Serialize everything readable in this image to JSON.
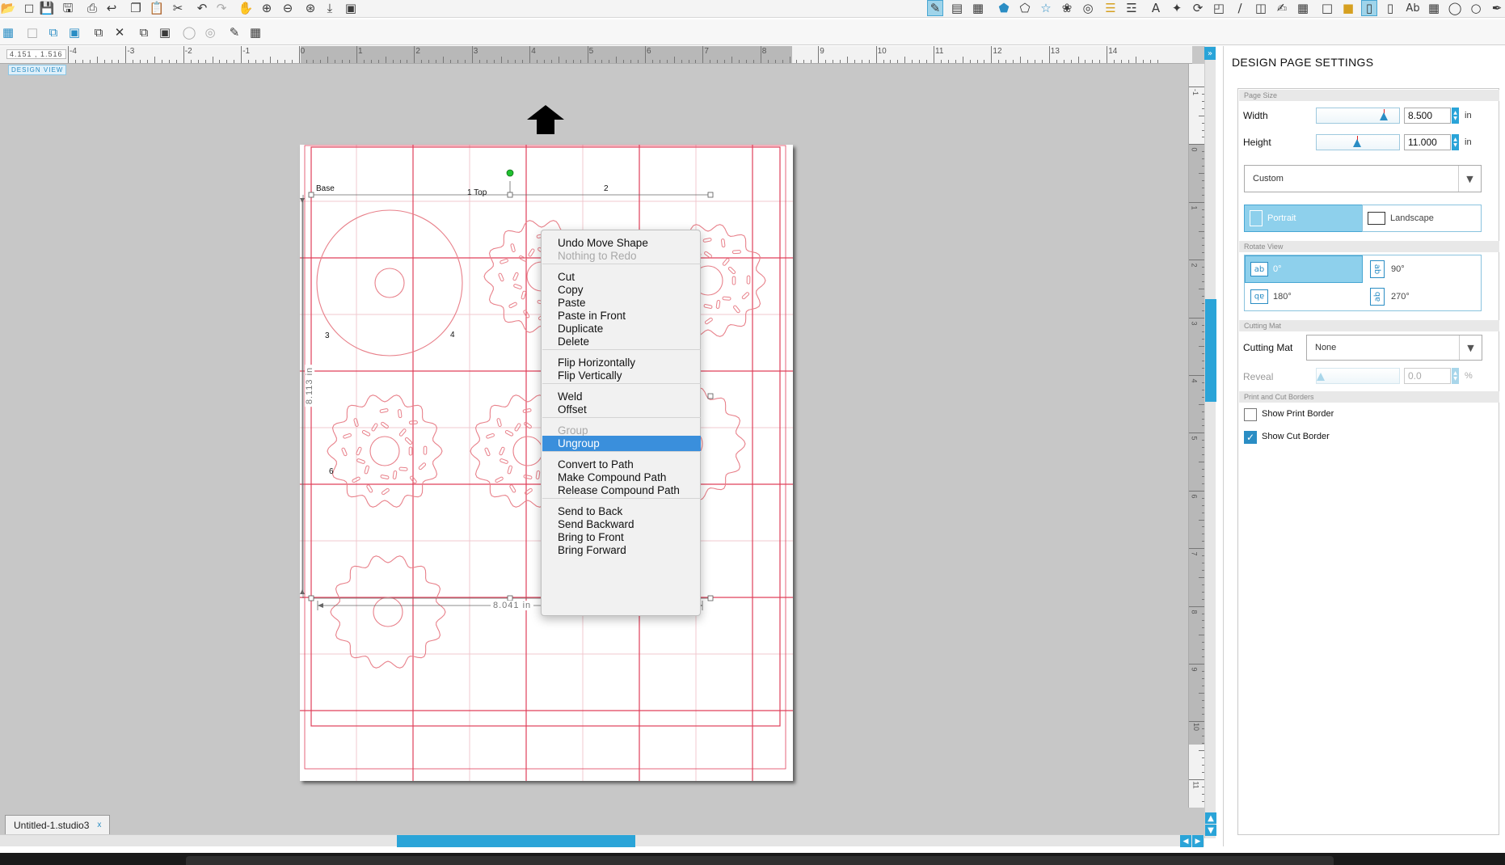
{
  "toolbar": {
    "left_icons": [
      "open-folder-icon",
      "new-document-icon",
      "save-icon",
      "save-as-icon",
      "print-icon",
      "send-icon",
      "copy-icon",
      "paste-icon",
      "cut-icon",
      "undo-icon",
      "redo-icon",
      "pan-icon",
      "zoom-in-icon",
      "zoom-out-icon",
      "zoom-select-icon",
      "zoom-fit-icon",
      "fit-page-icon"
    ],
    "right_icons": [
      "design-page-icon",
      "page-setup-icon",
      "registration-icon",
      "shape-icon",
      "fill-icon",
      "line-style-icon",
      "text-style-icon",
      "align-icon",
      "replicate-icon",
      "offset-icon",
      "trace-icon",
      "modify-icon",
      "transform-icon",
      "knife-icon",
      "layers-icon",
      "sketch-icon",
      "library-icon",
      "store-icon",
      "print-cut-icon",
      "send-icon",
      "settings-icon",
      "grid-icon",
      "image-effects-icon",
      "text-icon",
      "tracing-icon",
      "pen-icon"
    ],
    "second_icons": [
      "group-icon",
      "ungroup-icon",
      "compound-path-icon",
      "release-compound-icon",
      "weld-icon",
      "subtract-icon",
      "duplicate-icon",
      "offset-icon",
      "eraser-icon",
      "knife-icon",
      "pixscan-icon",
      "draw-icon",
      "fill-icon"
    ]
  },
  "ruler": {
    "top_numbers": [
      "-4",
      "-3",
      "-2",
      "-1",
      "0",
      "1",
      "2",
      "3",
      "4",
      "5",
      "6",
      "7",
      "8",
      "9",
      "10",
      "11",
      "12",
      "13",
      "14"
    ],
    "right_numbers": [
      "-1",
      "0",
      "1",
      "2",
      "3",
      "4",
      "5",
      "6",
      "7",
      "8",
      "9",
      "10",
      "11"
    ]
  },
  "coordinates": "4.151 , 1.516",
  "view_label": "DESIGN VIEW",
  "canvas": {
    "labels": [
      "Base",
      "1 Top",
      "2",
      "3",
      "4",
      "6"
    ],
    "dim_width": "8.041 in",
    "dim_height": "8.113 in"
  },
  "context_menu": {
    "groups": [
      [
        {
          "label": "Undo Move Shape",
          "enabled": true
        },
        {
          "label": "Nothing to Redo",
          "enabled": false
        }
      ],
      [
        {
          "label": "Cut",
          "enabled": true
        },
        {
          "label": "Copy",
          "enabled": true
        },
        {
          "label": "Paste",
          "enabled": true
        },
        {
          "label": "Paste in Front",
          "enabled": true
        },
        {
          "label": "Duplicate",
          "enabled": true
        },
        {
          "label": "Delete",
          "enabled": true
        }
      ],
      [
        {
          "label": "Flip Horizontally",
          "enabled": true
        },
        {
          "label": "Flip Vertically",
          "enabled": true
        }
      ],
      [
        {
          "label": "Weld",
          "enabled": true
        },
        {
          "label": "Offset",
          "enabled": true
        }
      ],
      [
        {
          "label": "Group",
          "enabled": false
        },
        {
          "label": "Ungroup",
          "enabled": true,
          "highlighted": true
        }
      ],
      [
        {
          "label": "Convert to Path",
          "enabled": true
        },
        {
          "label": "Make Compound Path",
          "enabled": true
        },
        {
          "label": "Release Compound Path",
          "enabled": true
        }
      ],
      [
        {
          "label": "Send to Back",
          "enabled": true
        },
        {
          "label": "Send Backward",
          "enabled": true
        },
        {
          "label": "Bring to Front",
          "enabled": true
        },
        {
          "label": "Bring Forward",
          "enabled": true
        }
      ]
    ]
  },
  "document_tab": {
    "name": "Untitled-1.studio3",
    "close": "x"
  },
  "panel": {
    "title": "DESIGN PAGE SETTINGS",
    "page_size": {
      "header": "Page Size",
      "width_label": "Width",
      "width_value": "8.500",
      "width_unit": "in",
      "height_label": "Height",
      "height_value": "11.000",
      "height_unit": "in",
      "preset": "Custom",
      "portrait": "Portrait",
      "landscape": "Landscape",
      "orientation_selected": "Portrait"
    },
    "rotate_view": {
      "header": "Rotate View",
      "options": [
        "0°",
        "90°",
        "180°",
        "270°"
      ],
      "glyphs": [
        "ab",
        "ab",
        "ab",
        "ab"
      ],
      "selected": "0°"
    },
    "cutting_mat": {
      "header": "Cutting Mat",
      "label": "Cutting Mat",
      "value": "None",
      "reveal_label": "Reveal",
      "reveal_value": "0.0",
      "reveal_unit": "%"
    },
    "print_cut_borders": {
      "header": "Print and Cut Borders",
      "show_print_border": "Show Print Border",
      "show_print_border_checked": false,
      "show_cut_border": "Show Cut Border",
      "show_cut_border_checked": true
    }
  },
  "colors": {
    "accent": "#2aa4d8",
    "cut_line": "#e0405a",
    "highlight": "#3a8fdc",
    "canvas_bg": "#c7c7c7"
  }
}
